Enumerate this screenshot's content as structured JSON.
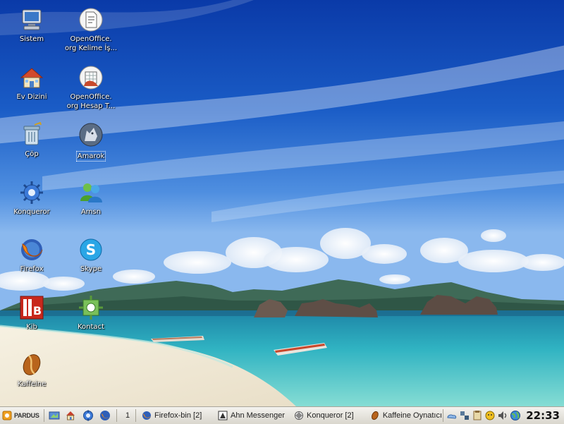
{
  "desktop": {
    "icons": [
      {
        "label": "Sistem",
        "icon": "computer-icon",
        "col": 0,
        "row": 0
      },
      {
        "label": "OpenOffice.\norg Kelime İş...",
        "icon": "writer-document-icon",
        "col": 1,
        "row": 0
      },
      {
        "label": "Ev Dizini",
        "icon": "home-folder-icon",
        "col": 0,
        "row": 1
      },
      {
        "label": "OpenOffice.\norg Hesap T...",
        "icon": "calc-spreadsheet-icon",
        "col": 1,
        "row": 1
      },
      {
        "label": "Çöp",
        "icon": "trash-icon",
        "col": 0,
        "row": 2
      },
      {
        "label": "Amarok",
        "icon": "amarok-wolf-icon",
        "col": 1,
        "row": 2,
        "selected": true
      },
      {
        "label": "Konqueror",
        "icon": "konqueror-gear-icon",
        "col": 0,
        "row": 3
      },
      {
        "label": "Amsn",
        "icon": "amsn-buddies-icon",
        "col": 1,
        "row": 3
      },
      {
        "label": "Firefox",
        "icon": "firefox-icon",
        "col": 0,
        "row": 4
      },
      {
        "label": "Skype",
        "icon": "skype-icon",
        "col": 1,
        "row": 4
      },
      {
        "label": "Kib",
        "icon": "kib-icon",
        "col": 0,
        "row": 5
      },
      {
        "label": "Kontact",
        "icon": "kontact-icon",
        "col": 1,
        "row": 5
      },
      {
        "label": "Kaffeine",
        "icon": "kaffeine-icon",
        "col": 0,
        "row": 6
      }
    ]
  },
  "taskbar": {
    "start_label": "PARDUS",
    "desktop_number": "1",
    "tasks": [
      {
        "label": "Firefox-bin [2]",
        "icon": "firefox-icon"
      },
      {
        "label": "Ahn Messenger",
        "icon": "messenger-icon"
      },
      {
        "label": "Konqueror [2]",
        "icon": "konqueror-icon"
      },
      {
        "label": "Kaffeine Oynatıcı",
        "icon": "kaffeine-icon"
      }
    ],
    "tray": [
      "weather-icon",
      "network-icon",
      "clipboard-icon",
      "messenger-tray-icon",
      "audio-icon",
      "globe-icon"
    ],
    "clock": "22:33"
  }
}
